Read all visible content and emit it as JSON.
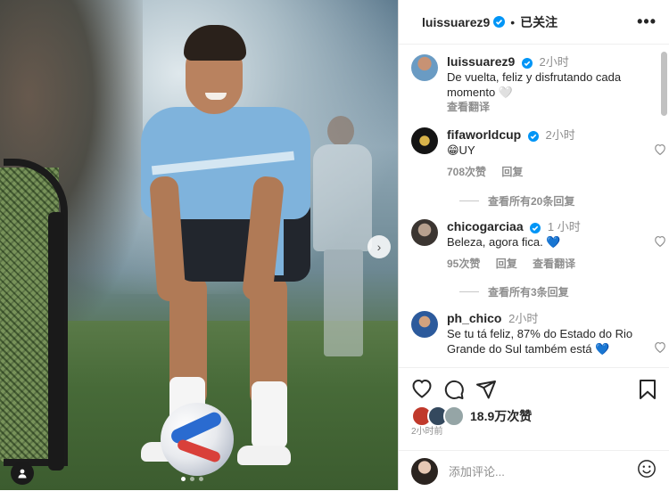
{
  "header": {
    "username": "luissuarez9",
    "follow_status": "已关注",
    "more_label": "•••"
  },
  "caption": {
    "username": "luissuarez9",
    "time": "2小时",
    "text": "De vuelta, feliz y disfrutando cada momento 🤍",
    "translate": "查看翻译"
  },
  "comments": [
    {
      "username": "fifaworldcup",
      "verified": true,
      "time": "2小时",
      "text": "😁UY",
      "likes": "708次赞",
      "reply": "回复",
      "translate": "",
      "view_replies": "查看所有20条回复"
    },
    {
      "username": "chicogarciaa",
      "verified": true,
      "time": "1 小时",
      "text": "Beleza, agora fica. 💙",
      "likes": "95次赞",
      "reply": "回复",
      "translate": "查看翻译",
      "view_replies": "查看所有3条回复"
    },
    {
      "username": "ph_chico",
      "verified": false,
      "time": "2小时",
      "text": "Se tu tá feliz, 87% do Estado do Rio Grande do Sul também está 💙",
      "likes": "",
      "reply": "",
      "translate": "",
      "view_replies": ""
    }
  ],
  "footer": {
    "likes": "18.9万次赞",
    "posted": "2小时前",
    "comment_placeholder": "添加评论...",
    "post_label": ""
  },
  "media": {
    "carousel_count": 3,
    "carousel_active": 1
  },
  "colors": {
    "verified_blue": "#0095f6",
    "muted": "#8e8e8e",
    "text": "#262626"
  },
  "icons": [
    "more-icon",
    "verified-icon",
    "heart-icon",
    "comment-icon",
    "share-icon",
    "bookmark-icon",
    "emoji-icon",
    "chevron-right-icon",
    "user-tag-icon"
  ]
}
